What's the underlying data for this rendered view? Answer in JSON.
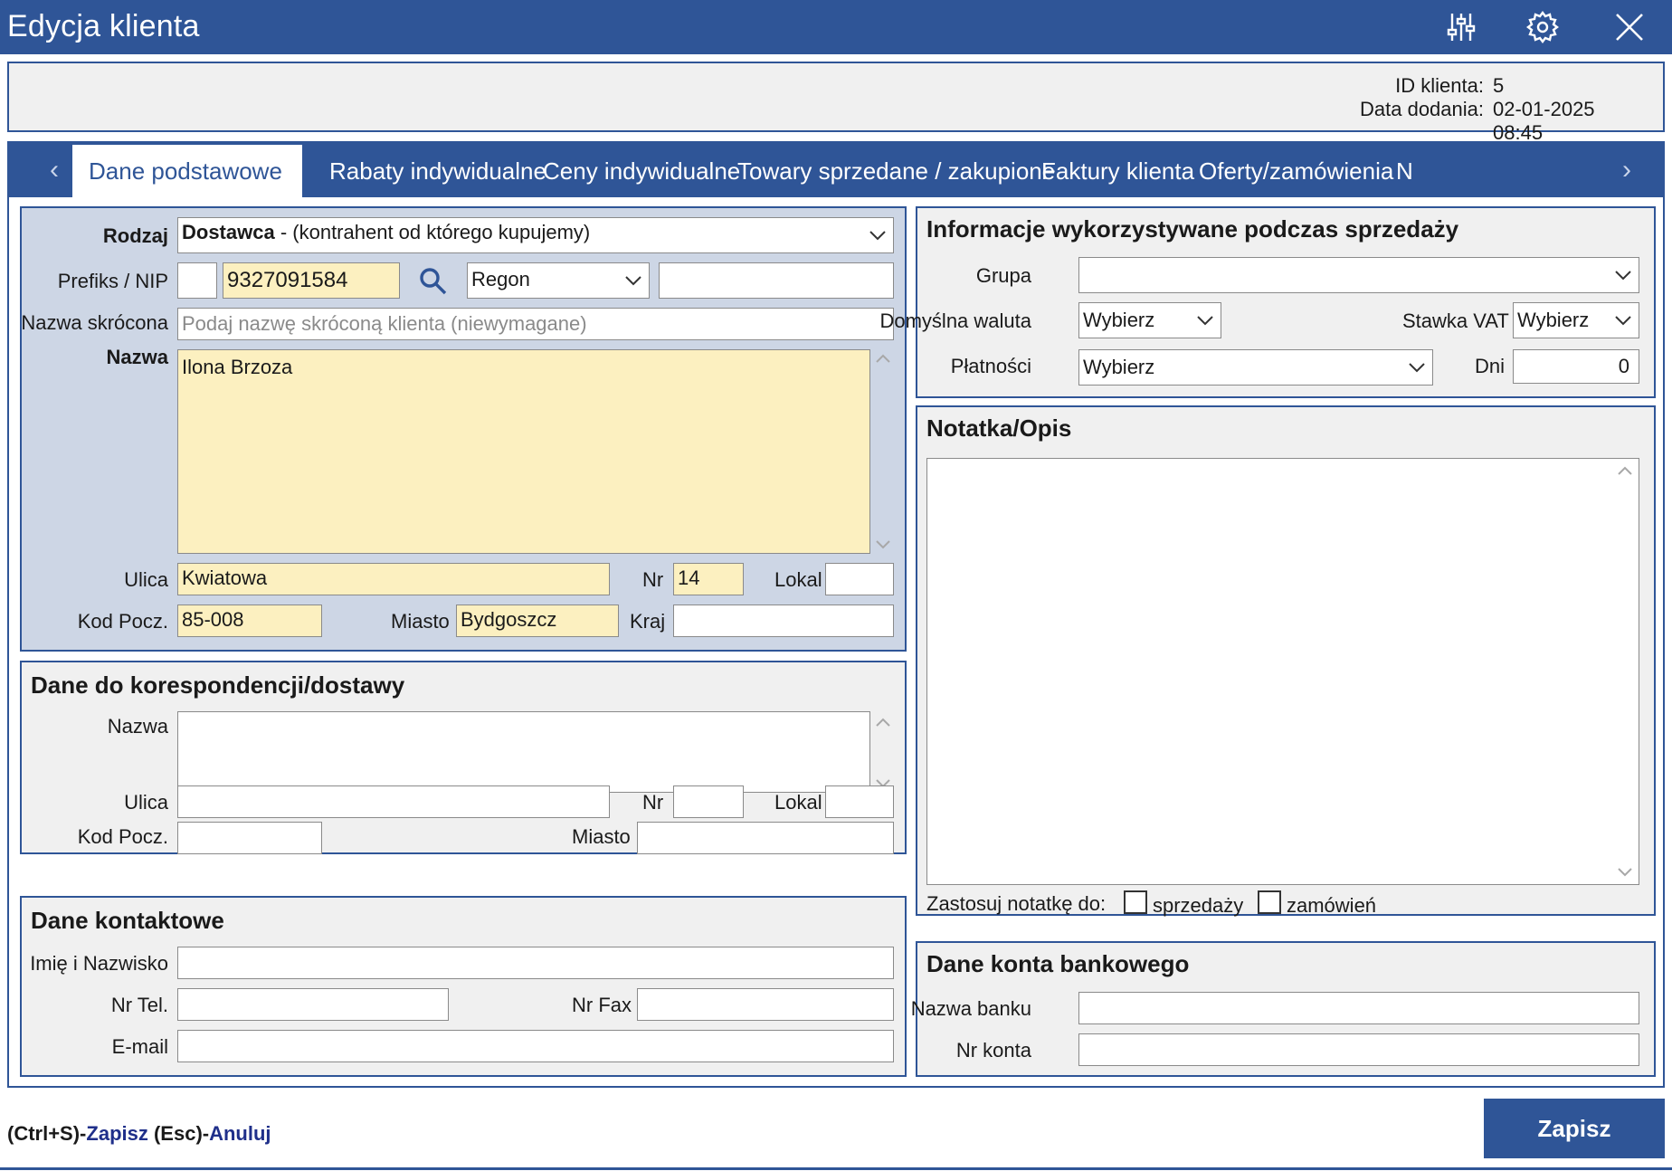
{
  "window": {
    "title": "Edycja klienta",
    "icons": [
      "sliders-icon",
      "gear-icon",
      "close-icon"
    ]
  },
  "info": {
    "client_id_label": "ID klienta:",
    "client_id_value": "5",
    "date_label": "Data dodania:",
    "date_value": "02-01-2025 08:45"
  },
  "tabs": [
    {
      "label": "Dane podstawowe",
      "active": true
    },
    {
      "label": "Rabaty indywidualne"
    },
    {
      "label": "Ceny indywidualne"
    },
    {
      "label": "Towary sprzedane / zakupione"
    },
    {
      "label": "Faktury klienta"
    },
    {
      "label": "Oferty/zamówienia"
    },
    {
      "label": "N"
    }
  ],
  "basic": {
    "rodzaj_label": "Rodzaj",
    "rodzaj_value_bold": "Dostawca",
    "rodzaj_value_rest": " - (kontrahent od którego kupujemy)",
    "nip_label": "Prefiks / NIP",
    "prefix_value": "",
    "nip_value": "9327091584",
    "regon_select": "Regon",
    "regon_value": "",
    "short_name_label": "Nazwa skrócona",
    "short_name_placeholder": "Podaj nazwę skróconą klienta (niewymagane)",
    "name_label": "Nazwa",
    "name_value": "Ilona Brzoza",
    "street_label": "Ulica",
    "street_value": "Kwiatowa",
    "nr_label": "Nr",
    "nr_value": "14",
    "local_label": "Lokal",
    "local_value": "",
    "postal_label": "Kod Pocz.",
    "postal_value": "85-008",
    "city_label": "Miasto",
    "city_value": "Bydgoszcz",
    "country_label": "Kraj",
    "country_value": ""
  },
  "correspondence": {
    "title": "Dane do korespondencji/dostawy",
    "name_label": "Nazwa",
    "street_label": "Ulica",
    "nr_label": "Nr",
    "local_label": "Lokal",
    "postal_label": "Kod Pocz.",
    "city_label": "Miasto"
  },
  "contact": {
    "title": "Dane kontaktowe",
    "fullname_label": "Imię i Nazwisko",
    "phone_label": "Nr Tel.",
    "fax_label": "Nr Fax",
    "email_label": "E-mail"
  },
  "sales": {
    "title": "Informacje wykorzystywane podczas sprzedaży",
    "group_label": "Grupa",
    "group_value": "",
    "currency_label": "Domyślna waluta",
    "currency_value": "Wybierz",
    "vat_label": "Stawka VAT",
    "vat_value": "Wybierz",
    "payments_label": "Płatności",
    "payments_value": "Wybierz",
    "days_label": "Dni",
    "days_value": "0"
  },
  "note": {
    "title": "Notatka/Opis",
    "apply_label": "Zastosuj notatkę do:",
    "sales_checkbox": "sprzedaży",
    "orders_checkbox": "zamówień"
  },
  "bank": {
    "title": "Dane konta bankowego",
    "bank_name_label": "Nazwa banku",
    "account_label": "Nr konta"
  },
  "footer": {
    "shortcut_save_key": "(Ctrl+S)-",
    "shortcut_save": "Zapisz",
    "shortcut_cancel_key": " (Esc)-",
    "shortcut_cancel": "Anuluj",
    "save_button": "Zapisz"
  },
  "colors": {
    "accent": "#2f5597",
    "highlight_field": "#fcf0c0",
    "panel_blue": "#cdd6e5",
    "panel_gray": "#f0f0f0"
  }
}
